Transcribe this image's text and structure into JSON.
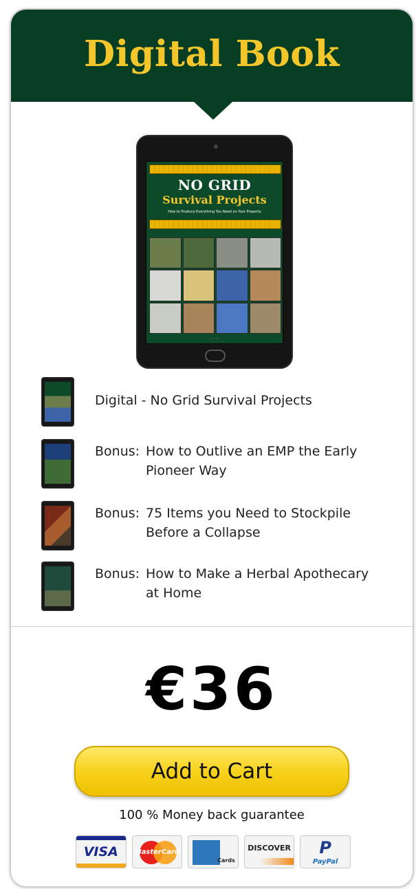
{
  "header": {
    "title": "Digital Book"
  },
  "cover": {
    "title": "NO GRID",
    "subtitle": "Survival Projects",
    "tagline": "How to Produce Everything You Need on Your Property"
  },
  "items": [
    {
      "prefix": "",
      "line1": "Digital - No Grid Survival Projects",
      "line2": ""
    },
    {
      "prefix": "Bonus:",
      "line1": "How to Outlive an EMP the Early",
      "line2": "Pioneer Way"
    },
    {
      "prefix": "Bonus:",
      "line1": "75 Items you Need to Stockpile",
      "line2": "Before a Collapse"
    },
    {
      "prefix": "Bonus:",
      "line1": "How to Make a Herbal Apothecary",
      "line2": "at Home"
    }
  ],
  "price": "€36",
  "cart_button": "Add to Cart",
  "guarantee": "100 % Money back guarantee",
  "payments": {
    "visa": "VISA",
    "mastercard": "MasterCard",
    "amex_label": "Cards",
    "discover": "DISCOVER",
    "paypal_letter": "P",
    "paypal": "PayPal"
  },
  "colors": {
    "header_bg": "#073d22",
    "header_text": "#f3c72b",
    "button_bg": "#f8d21c"
  },
  "icons": {
    "thumbs": [
      "book-thumbnail-icon",
      "book-thumbnail-icon",
      "book-thumbnail-icon",
      "book-thumbnail-icon"
    ]
  }
}
